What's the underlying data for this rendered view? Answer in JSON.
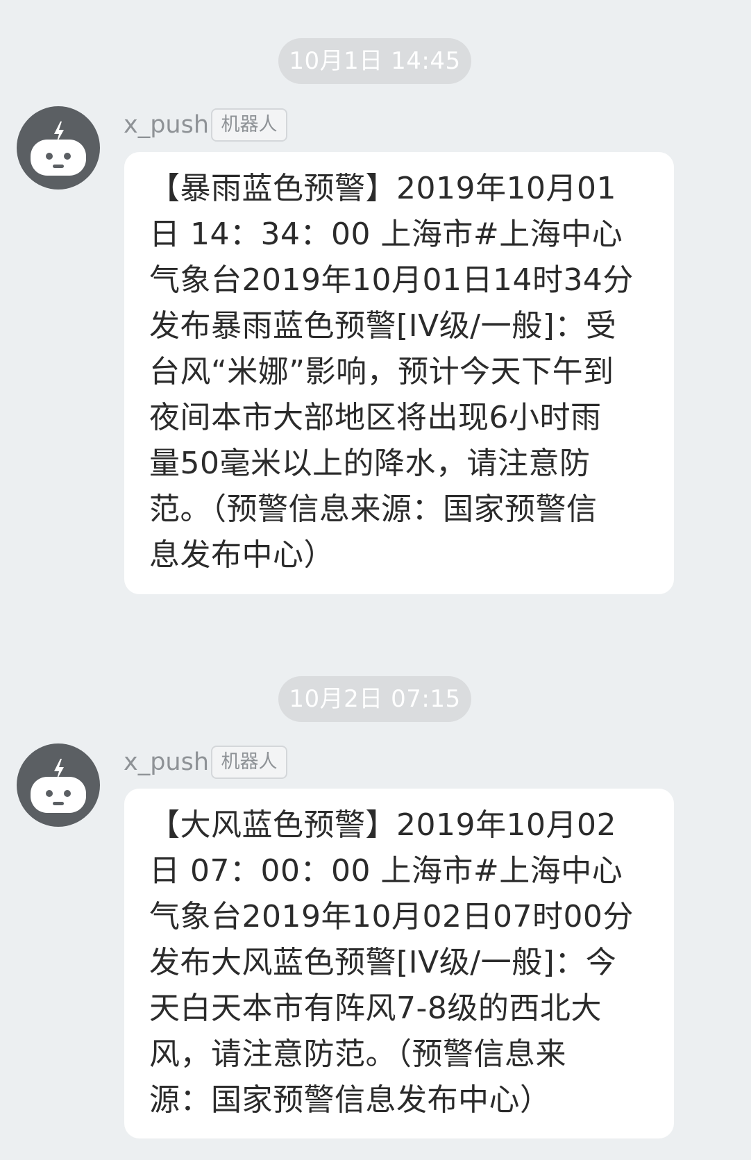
{
  "messages": [
    {
      "timestamp": "10月1日 14:45",
      "sender": "x_push",
      "badge": "机器人",
      "text": "【暴雨蓝色预警】2019年10月01\n日 14：34：00 上海市#上海中心\n气象台2019年10月01日14时34分\n发布暴雨蓝色预警[IV级/一般]：受\n台风“米娜”影响，预计今天下午到\n夜间本市大部地区将出现6小时雨\n量50毫米以上的降水，请注意防\n范。（预警信息来源：国家预警信\n息发布中心）"
    },
    {
      "timestamp": "10月2日 07:15",
      "sender": "x_push",
      "badge": "机器人",
      "text": "【大风蓝色预警】2019年10月02\n日 07：00：00 上海市#上海中心\n气象台2019年10月02日07时00分\n发布大风蓝色预警[IV级/一般]：今\n天白天本市有阵风7-8级的西北大\n风，请注意防范。（预警信息来\n源：国家预警信息发布中心）"
    }
  ],
  "icons": {
    "avatar": "robot-icon"
  },
  "colors": {
    "background": "#eceff1",
    "bubble": "#ffffff",
    "timestamp_pill": "#dadcde",
    "avatar": "#5b5f63"
  }
}
